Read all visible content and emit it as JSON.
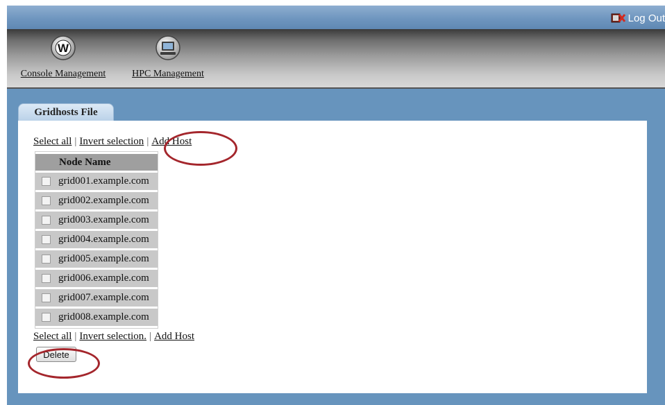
{
  "header": {
    "logout_label": "Log Out"
  },
  "nav": [
    {
      "label": "Console Management",
      "icon": "w-logo-icon"
    },
    {
      "label": "HPC Management",
      "icon": "computer-monitor-icon"
    }
  ],
  "tab": {
    "label": "Gridhosts File"
  },
  "actions": {
    "select_all": "Select all",
    "separator": "|",
    "invert_selection_top": "Invert selection",
    "invert_selection_bottom": "Invert selection.",
    "add_host": "Add Host",
    "delete": "Delete"
  },
  "table": {
    "columns": [
      "",
      "Node Name"
    ],
    "rows": [
      {
        "node": "grid001.example.com",
        "checked": false
      },
      {
        "node": "grid002.example.com",
        "checked": false
      },
      {
        "node": "grid003.example.com",
        "checked": false
      },
      {
        "node": "grid004.example.com",
        "checked": false
      },
      {
        "node": "grid005.example.com",
        "checked": false
      },
      {
        "node": "grid006.example.com",
        "checked": false
      },
      {
        "node": "grid007.example.com",
        "checked": false
      },
      {
        "node": "grid008.example.com",
        "checked": false
      }
    ]
  },
  "colors": {
    "background": "#6794bd",
    "annotation": "#a4262c"
  }
}
